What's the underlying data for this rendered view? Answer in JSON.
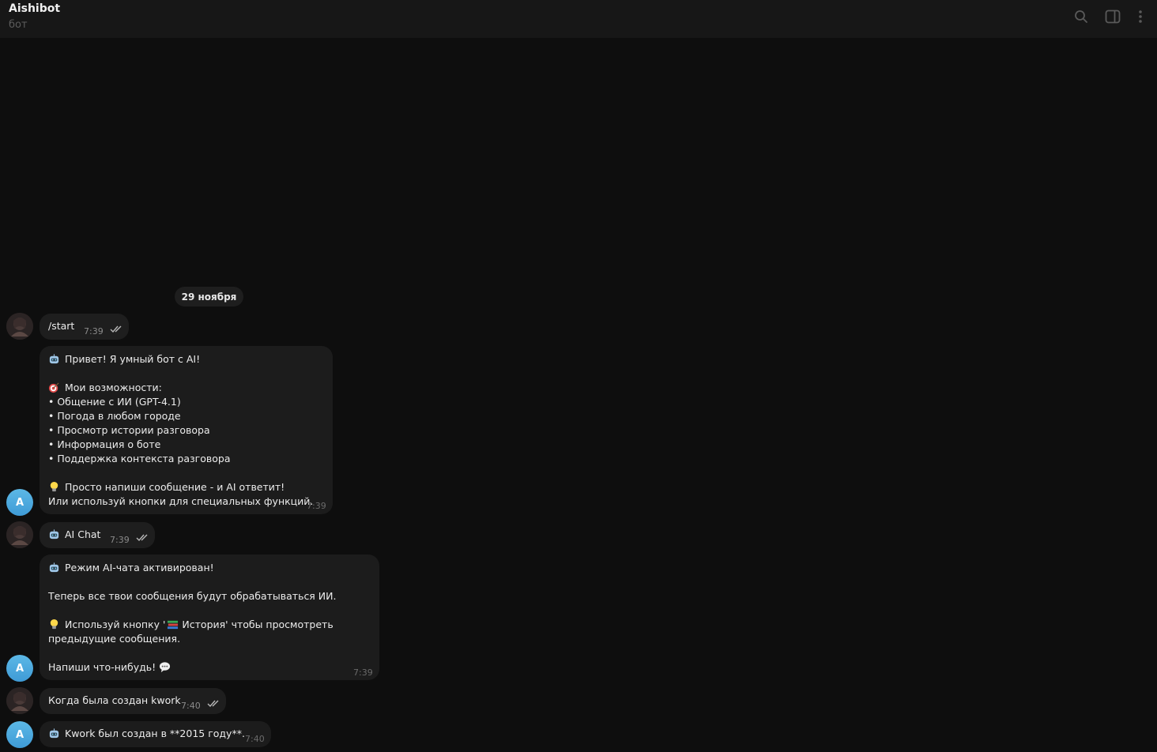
{
  "header": {
    "title": "Aishibot",
    "subtitle": "бот",
    "icons": [
      "search-icon",
      "sidebar-toggle-icon",
      "more-vert-icon"
    ]
  },
  "chat": {
    "date_separator": "29 ноября",
    "user_avatar_icon": "user-avatar",
    "bot_avatar_letter": "A",
    "messages": [
      {
        "from": "user",
        "text": "/start",
        "time": "7:39",
        "status": "read"
      },
      {
        "from": "bot",
        "time": "7:39",
        "lines": [
          "Привет! Я умный бот с AI!",
          "",
          "Мои возможности:",
          "• Общение с ИИ (GPT-4.1)",
          "• Погода в любом городе",
          "• Просмотр истории разговора",
          "• Информация о боте",
          "• Поддержка контекста разговора",
          "",
          "Просто напиши сообщение - и AI ответит!",
          "Или используй кнопки для специальных функций."
        ]
      },
      {
        "from": "user",
        "text": "AI Chat",
        "time": "7:39",
        "status": "read"
      },
      {
        "from": "bot",
        "time": "7:39",
        "lines": [
          "Режим AI-чата активирован!",
          "",
          "Теперь все твои сообщения будут обрабатываться ИИ.",
          "",
          "Используй кнопку '",
          " История' чтобы просмотреть",
          "предыдущие сообщения.",
          "",
          "Напиши что-нибудь!"
        ]
      },
      {
        "from": "user",
        "text": "Когда была создан kwork",
        "time": "7:40",
        "status": "read"
      },
      {
        "from": "bot",
        "text": "Kwork был создан в **2015 году**.",
        "time": "7:40"
      }
    ]
  }
}
